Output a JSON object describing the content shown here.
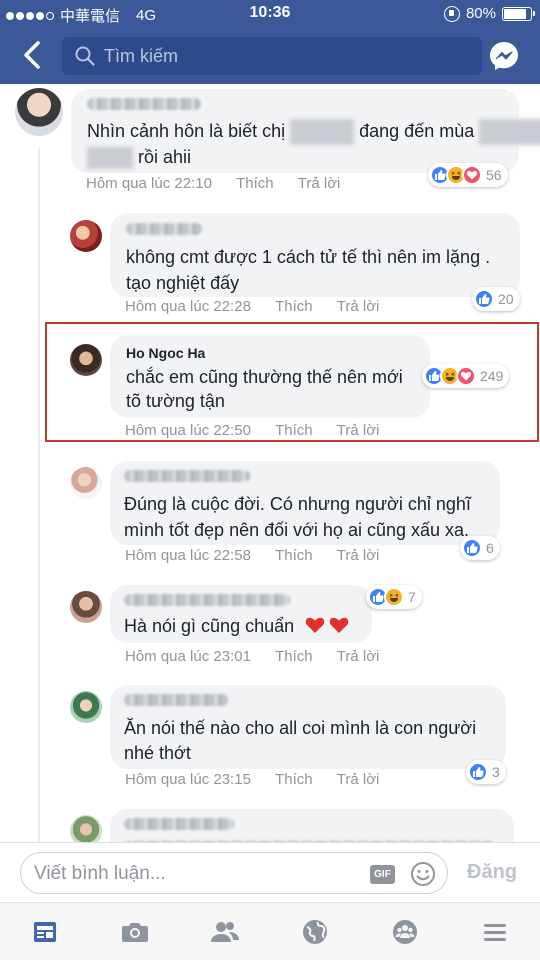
{
  "status_bar": {
    "carrier": "中華電信",
    "network": "4G",
    "time": "10:36",
    "battery": "80%"
  },
  "nav": {
    "search_placeholder": "Tìm kiếm"
  },
  "comments": [
    {
      "author": "",
      "text_line1_a": "Nhìn cảnh hôn là biết chị ",
      "text_line1_b": " đang đến mùa ",
      "text_line2": " rồi ahii",
      "time": "Hôm qua lúc 22:10",
      "like": "Thích",
      "reply": "Trả lời",
      "reaction_count": "56"
    },
    {
      "author": "",
      "text_line1": "không cmt được 1 cách tử tế thì nên im lặng .",
      "text_line2": "tạo nghiệt đấy",
      "time": "Hôm qua lúc 22:28",
      "like": "Thích",
      "reply": "Trả lời",
      "reaction_count": "20"
    },
    {
      "author": "Ho Ngoc Ha",
      "text_line1": "chắc em cũng thường thế nên mới",
      "text_line2": "tõ tường tận",
      "time": "Hôm qua lúc 22:50",
      "like": "Thích",
      "reply": "Trả lời",
      "reaction_count": "249"
    },
    {
      "author": "",
      "text_line1": "Đúng là cuộc đời. Có nhưng người chỉ nghĩ",
      "text_line2": "mình tốt đẹp nên đối với họ ai cũng xấu xa.",
      "time": "Hôm qua lúc 22:58",
      "like": "Thích",
      "reply": "Trả lời",
      "reaction_count": "6"
    },
    {
      "author": "",
      "text_line1": "Hà nói gì cũng chuẩn",
      "time": "Hôm qua lúc 23:01",
      "like": "Thích",
      "reply": "Trả lời",
      "reaction_count": "7"
    },
    {
      "author": "",
      "text_line1": "Ăn nói thế nào cho all coi mình là con người",
      "text_line2": "nhé thớt",
      "time": "Hôm qua lúc 23:15",
      "like": "Thích",
      "reply": "Trả lời",
      "reaction_count": "3"
    }
  ],
  "composer": {
    "placeholder": "Viết bình luận...",
    "gif_label": "GIF",
    "post_label": "Đăng"
  },
  "icons": {
    "like": "like-icon",
    "haha": "haha-icon",
    "love": "love-icon"
  },
  "colors": {
    "brand": "#3b5998",
    "like": "#4080ff",
    "love": "#f25268",
    "haha": "#f7b125",
    "highlight_border": "#c0392b"
  }
}
